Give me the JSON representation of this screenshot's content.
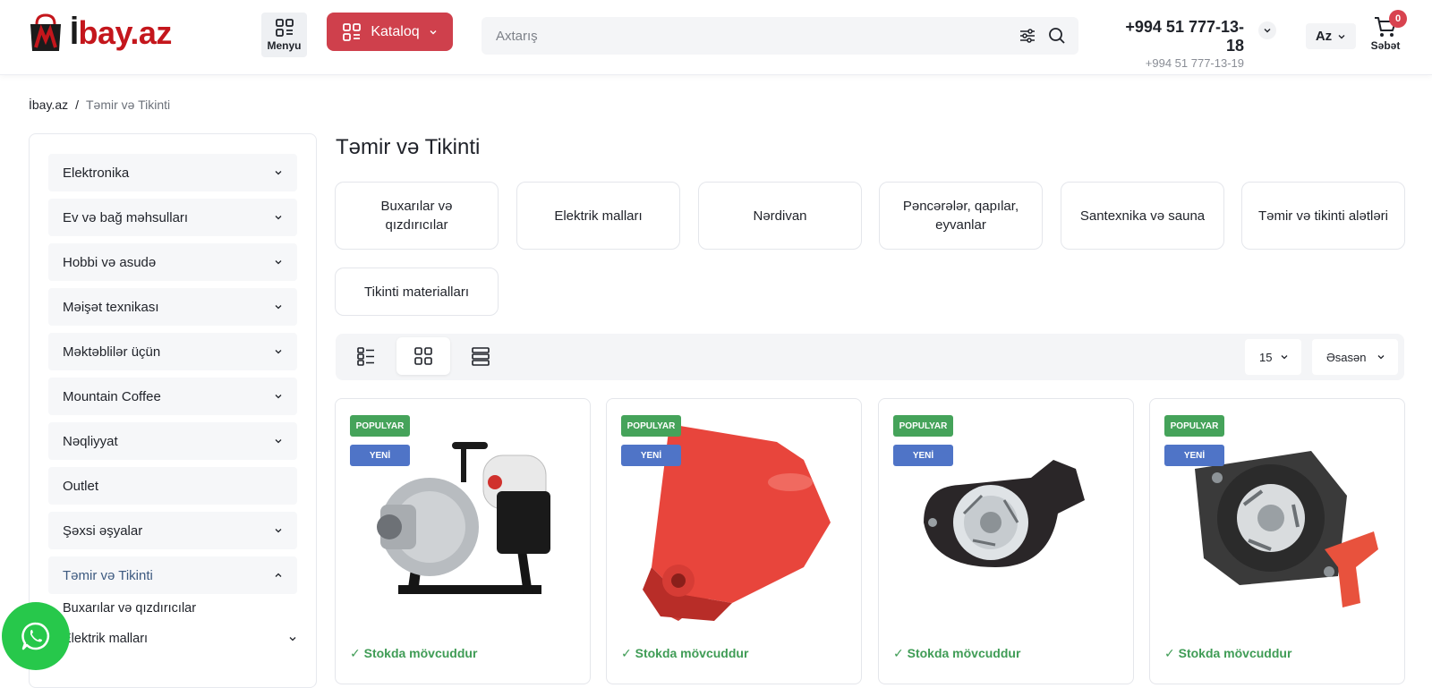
{
  "header": {
    "logo_text_first": "İ",
    "logo_text_rest": "bay.az",
    "menu_label": "Menyu",
    "katalog_label": "Kataloq",
    "search_placeholder": "Axtarış",
    "phone_main": "+994 51 777-13-18",
    "phone_sub": "+994 51 777-13-19",
    "lang": "Az",
    "cart_count": "0",
    "cart_label": "Səbət"
  },
  "breadcrumb": {
    "home": "İbay.az",
    "separator": "/",
    "current": "Təmir və Tikinti"
  },
  "sidebar": {
    "items": [
      {
        "label": "Elektronika"
      },
      {
        "label": "Ev və bağ məhsulları"
      },
      {
        "label": "Hobbi və asudə"
      },
      {
        "label": "Məişət texnikası"
      },
      {
        "label": "Məktəblilər üçün"
      },
      {
        "label": "Mountain Coffee"
      },
      {
        "label": "Nəqliyyat"
      },
      {
        "label": "Outlet"
      },
      {
        "label": "Şəxsi əşyalar"
      },
      {
        "label": "Təmir və Tikinti"
      }
    ],
    "subitems": [
      {
        "label": "Buxarılar və qızdırıcılar"
      },
      {
        "label": "Elektrik malları"
      }
    ]
  },
  "main": {
    "title": "Təmir və Tikinti",
    "subcategories": [
      {
        "label": "Buxarılar və qızdırıcılar"
      },
      {
        "label": "Elektrik malları"
      },
      {
        "label": "Nərdivan"
      },
      {
        "label": "Pəncərələr, qapılar, eyvanlar"
      },
      {
        "label": "Santexnika və sauna"
      },
      {
        "label": "Təmir və tikinti alətləri"
      },
      {
        "label": "Tikinti materialları"
      }
    ],
    "per_page": "15",
    "sort": "Əsasən"
  },
  "products": [
    {
      "badge_popular": "POPULYAR",
      "badge_new": "YENİ",
      "stock": "✓ Stokda mövcuddur",
      "image": "water-pump"
    },
    {
      "badge_popular": "POPULYAR",
      "badge_new": "YENİ",
      "stock": "✓ Stokda mövcuddur",
      "image": "gearbox-housing"
    },
    {
      "badge_popular": "POPULYAR",
      "badge_new": "YENİ",
      "stock": "✓ Stokda mövcuddur",
      "image": "recoil-starter"
    },
    {
      "badge_popular": "POPULYAR",
      "badge_new": "YENİ",
      "stock": "✓ Stokda mövcuddur",
      "image": "recoil-starter-orange"
    }
  ],
  "colors": {
    "brand_red": "#cf404c",
    "popular_green": "#45a35a",
    "new_blue": "#4f74c7",
    "stock_green": "#3f9c55",
    "whatsapp_green": "#27c84b"
  }
}
